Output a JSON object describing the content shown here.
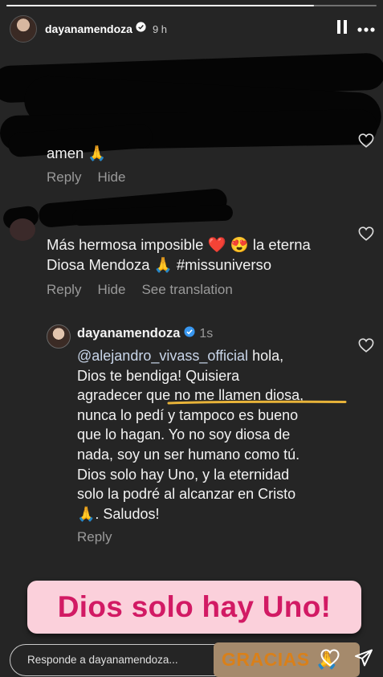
{
  "header": {
    "username": "dayanamendoza",
    "time": "9 h"
  },
  "comments": [
    {
      "text": "amen 🙏",
      "reply_label": "Reply",
      "hide_label": "Hide"
    },
    {
      "text_line1": "Más hermosa imposible ❤️ 😍 la eterna",
      "text_line2": "Diosa Mendoza 🙏 #missuniverso",
      "reply_label": "Reply",
      "hide_label": "Hide",
      "translate_label": "See translation"
    }
  ],
  "reply": {
    "username": "dayanamendoza",
    "time": "1s",
    "mention": "@alejandro_vivass_official",
    "lines": [
      " hola,",
      "Dios te bendiga! Quisiera",
      "agradecer que no me llamen diosa,",
      "nunca lo pedí y tampoco es bueno",
      "que lo hagan. Yo no soy diosa de",
      "nada, soy un ser humano como tú.",
      "Dios solo hay Uno, y la eternidad",
      "solo la podré al alcanzar en Cristo",
      "🙏. Saludos!"
    ],
    "reply_label": "Reply"
  },
  "sticker": {
    "text": "Dios solo hay Uno!"
  },
  "gracias": {
    "text": "GRACIAS 🙏"
  },
  "message_input": {
    "placeholder": "Responde a dayanamendoza..."
  },
  "colors": {
    "sticker_bg": "#fbd0db",
    "sticker_text": "#d21a64",
    "underline": "#e8b339",
    "mention": "#c9d6ea"
  }
}
